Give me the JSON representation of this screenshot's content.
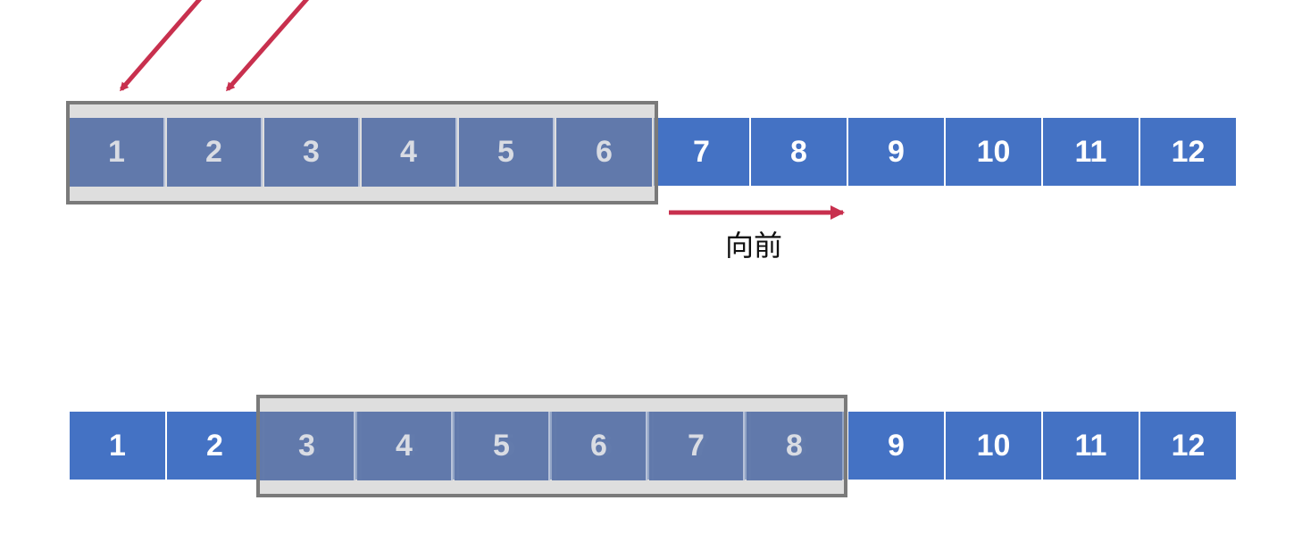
{
  "top_row": {
    "cells": [
      "1",
      "2",
      "3",
      "4",
      "5",
      "6",
      "7",
      "8",
      "9",
      "10",
      "11",
      "12"
    ],
    "window_cells": [
      "1",
      "2",
      "3",
      "4",
      "5",
      "6"
    ]
  },
  "bottom_row": {
    "cells": [
      "1",
      "2",
      "3",
      "4",
      "5",
      "6",
      "7",
      "8",
      "9",
      "10",
      "11",
      "12"
    ],
    "window_cells": [
      "3",
      "4",
      "5",
      "6",
      "7",
      "8"
    ]
  },
  "forward_label": "向前",
  "colors": {
    "cell_fill": "#4472c4",
    "cell_text": "#ffffff",
    "window_border": "#7a7a7a",
    "window_fill": "#d0d0d0",
    "arrow": "#c8304e"
  },
  "icons": {
    "forward_arrow": "right-arrow-icon",
    "pointer_arrows": "diagonal-down-left-arrow-icon"
  }
}
